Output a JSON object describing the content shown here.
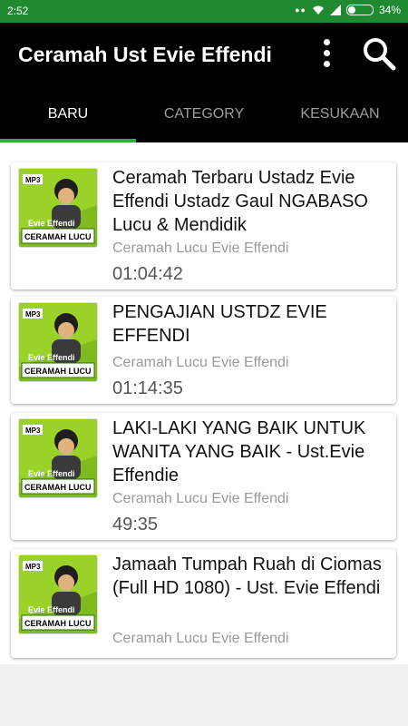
{
  "status": {
    "time": "2:52",
    "battery": "34%"
  },
  "app": {
    "title": "Ceramah Ust Evie Effendi"
  },
  "tabs": [
    {
      "label": "BARU",
      "active": true
    },
    {
      "label": "CATEGORY",
      "active": false
    },
    {
      "label": "KESUKAAN",
      "active": false
    }
  ],
  "thumbnail": {
    "badge": "MP3",
    "name": "Evie Effendi",
    "caption": "CERAMAH LUCU"
  },
  "items": [
    {
      "title": "Ceramah Terbaru Ustadz Evie Effendi Ustadz Gaul NGABASO  Lucu & Mendidik",
      "category": "Ceramah Lucu Evie Effendi",
      "duration": "01:04:42"
    },
    {
      "title": "PENGAJIAN USTDZ EVIE EFFENDI",
      "category": "Ceramah Lucu Evie Effendi",
      "duration": "01:14:35"
    },
    {
      "title": "LAKI-LAKI YANG BAIK UNTUK WANITA YANG BAIK - Ust.Evie Effendie",
      "category": "Ceramah Lucu Evie Effendi",
      "duration": "49:35"
    },
    {
      "title": "Jamaah Tumpah Ruah di Ciomas (Full HD 1080) - Ust. Evie Effendi",
      "category": "Ceramah Lucu Evie Effendi",
      "duration": ""
    }
  ]
}
